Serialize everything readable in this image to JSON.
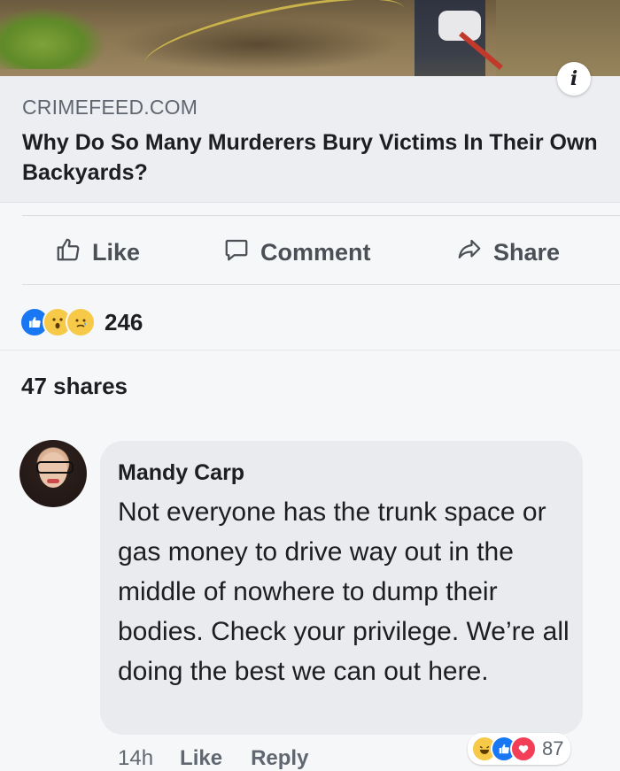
{
  "link_preview": {
    "domain": "CRIMEFEED.COM",
    "headline": "Why Do So Many Murderers Bury Victims In Their Own Backyards?",
    "info_icon": "info-icon"
  },
  "actions": {
    "like": "Like",
    "comment": "Comment",
    "share": "Share"
  },
  "reactions": {
    "icons": [
      "like-reaction-icon",
      "wow-reaction-icon",
      "sad-reaction-icon"
    ],
    "count": "246"
  },
  "shares": "47 shares",
  "comment": {
    "author": "Mandy Carp",
    "text": "Not everyone has the trunk space or gas money to drive way out in the middle of nowhere to dump their bodies. Check your privilege. We’re all doing the best we can out here.",
    "time": "14h",
    "like_label": "Like",
    "reply_label": "Reply",
    "reaction_icons": [
      "haha-reaction-icon",
      "like-reaction-icon",
      "love-reaction-icon"
    ],
    "reaction_count": "87"
  },
  "colors": {
    "facebook_blue": "#1877f2",
    "action_gray": "#4b4f56",
    "bubble": "#e9ebee"
  }
}
